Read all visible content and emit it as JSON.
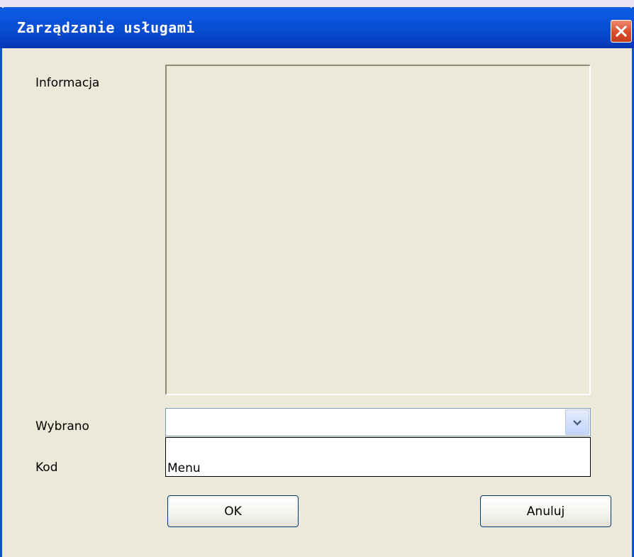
{
  "window": {
    "title": "Zarządzanie usługami"
  },
  "form": {
    "info_label": "Informacja",
    "selected_label": "Wybrano",
    "code_label": "Kod",
    "selected_value": "",
    "dropdown_items": [
      "Menu"
    ]
  },
  "buttons": {
    "ok_label": "OK",
    "cancel_label": "Anuluj"
  },
  "colors": {
    "titlebar": "#0846c8",
    "window_bg": "#ece9d8",
    "close_button": "#db4b2b"
  },
  "icons": {
    "close": "close-icon",
    "dropdown": "chevron-down-icon"
  }
}
